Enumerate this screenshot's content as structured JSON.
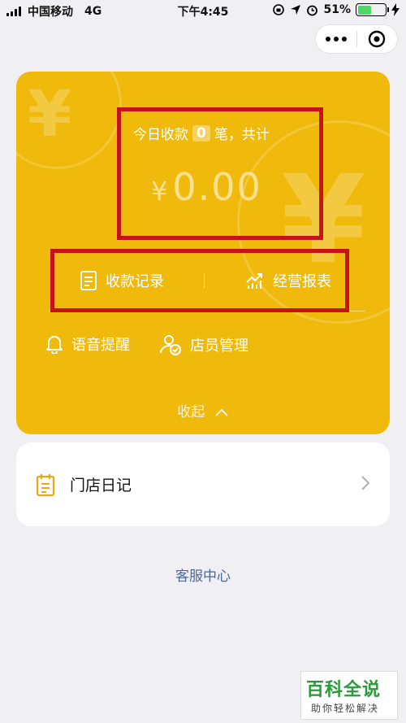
{
  "status_bar": {
    "carrier": "中国移动",
    "network": "4G",
    "time": "下午4:45",
    "battery_percent": "51%",
    "battery_level": 0.51
  },
  "capsule": {
    "more_icon": "more-icon",
    "close_icon": "target-icon"
  },
  "card": {
    "today_prefix": "今日收款",
    "today_count": "0",
    "today_suffix": "笔，共计",
    "amount_currency": "¥",
    "amount_value": "0.00",
    "records_label": "收款记录",
    "report_label": "经营报表",
    "voice_label": "语音提醒",
    "staff_label": "店员管理",
    "collapse_label": "收起",
    "colors": {
      "card": "#f0ba0c",
      "highlight_box": "#c8121a"
    }
  },
  "diary": {
    "label": "门店日记"
  },
  "service": {
    "label": "客服中心"
  },
  "watermark": {
    "title": "百科全说",
    "subtitle": "助你轻松解决"
  }
}
